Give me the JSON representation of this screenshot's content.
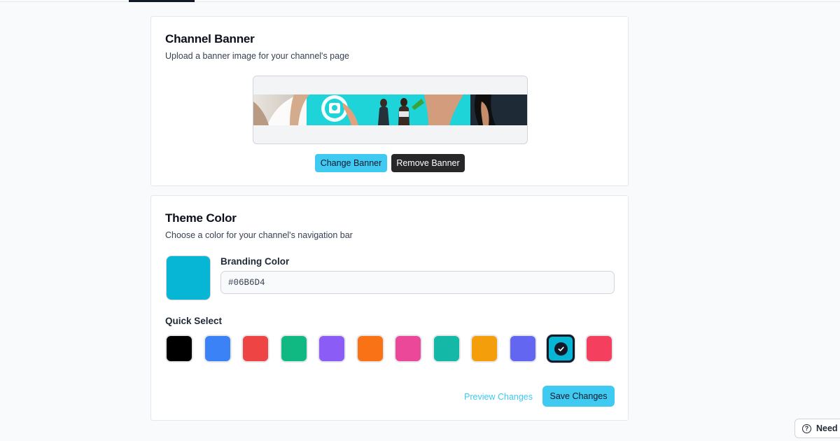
{
  "banner_section": {
    "title": "Channel Banner",
    "description": "Upload a banner image for your channel's page",
    "change_label": "Change Banner",
    "remove_label": "Remove Banner",
    "image_alt": "channel banner image"
  },
  "theme_section": {
    "title": "Theme Color",
    "description": "Choose a color for your channel's navigation bar",
    "branding_label": "Branding Color",
    "hex_value": "#06B6D4",
    "current_color": "#06B6D4",
    "quick_select_label": "Quick Select",
    "swatches": [
      {
        "color": "#000000",
        "selected": false
      },
      {
        "color": "#3B82F6",
        "selected": false
      },
      {
        "color": "#EF4444",
        "selected": false
      },
      {
        "color": "#10B981",
        "selected": false
      },
      {
        "color": "#8B5CF6",
        "selected": false
      },
      {
        "color": "#F97316",
        "selected": false
      },
      {
        "color": "#EC4899",
        "selected": false
      },
      {
        "color": "#14B8A6",
        "selected": false
      },
      {
        "color": "#F59E0B",
        "selected": false
      },
      {
        "color": "#6366F1",
        "selected": false
      },
      {
        "color": "#06B6D4",
        "selected": true
      },
      {
        "color": "#F43F5E",
        "selected": false
      }
    ],
    "preview_label": "Preview Changes",
    "save_label": "Save Changes"
  },
  "help": {
    "label": "Need h",
    "icon": "question-circle-icon"
  },
  "colors": {
    "accent": "#3FCAF2",
    "dark_button": "#27272A"
  }
}
